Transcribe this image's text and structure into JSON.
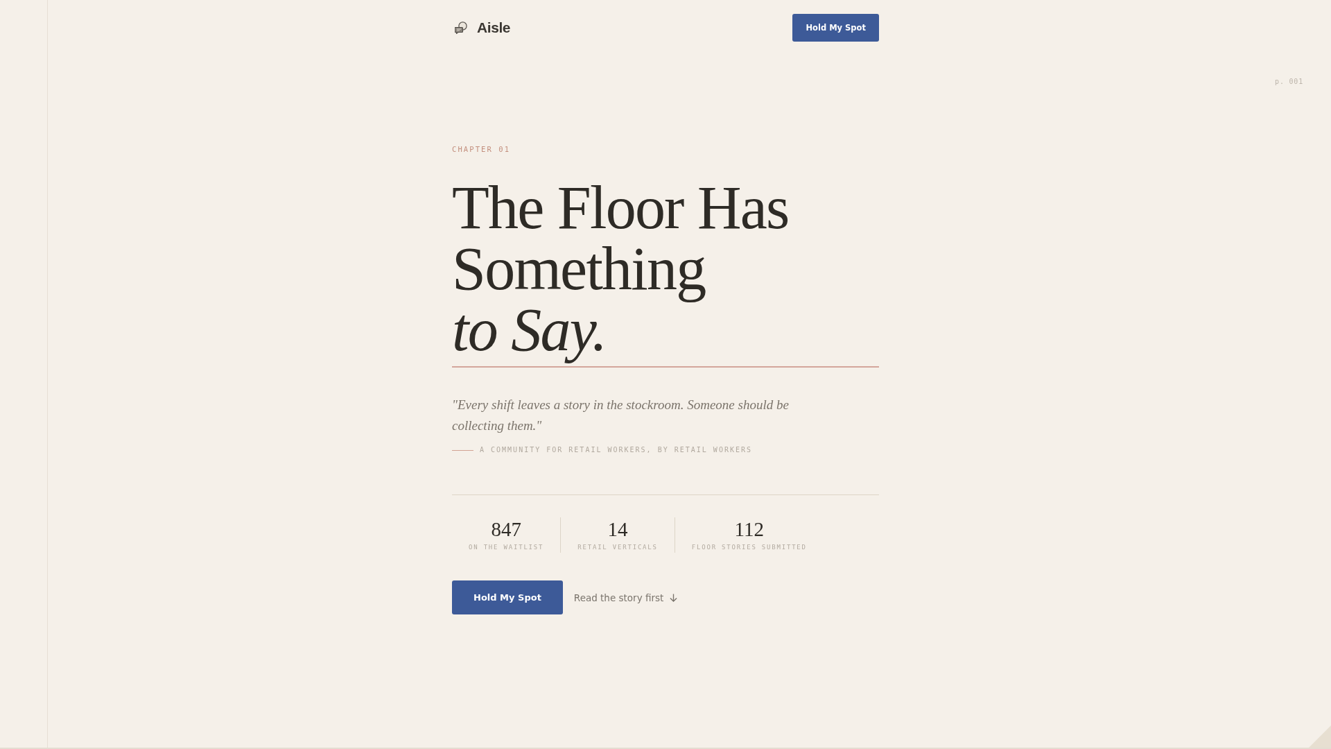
{
  "header": {
    "brand": "Aisle",
    "button": "Hold My Spot"
  },
  "page_number": "p. 001",
  "hero": {
    "eyebrow": "CHAPTER 01",
    "headline": "The Floor Has Something *to Say.*",
    "quote": "\"Every shift leaves a story in the stockroom. Someone should be collecting them.\"",
    "tagline": "A COMMUNITY FOR RETAIL WORKERS, BY RETAIL WORKERS"
  },
  "stats": [
    {
      "value": "847",
      "label": "ON THE WAITLIST"
    },
    {
      "value": "14",
      "label": "RETAIL VERTICALS"
    },
    {
      "value": "112",
      "label": "FLOOR STORIES SUBMITTED"
    }
  ],
  "actions": {
    "primary": "Hold My Spot",
    "secondary": "Read the story first"
  }
}
